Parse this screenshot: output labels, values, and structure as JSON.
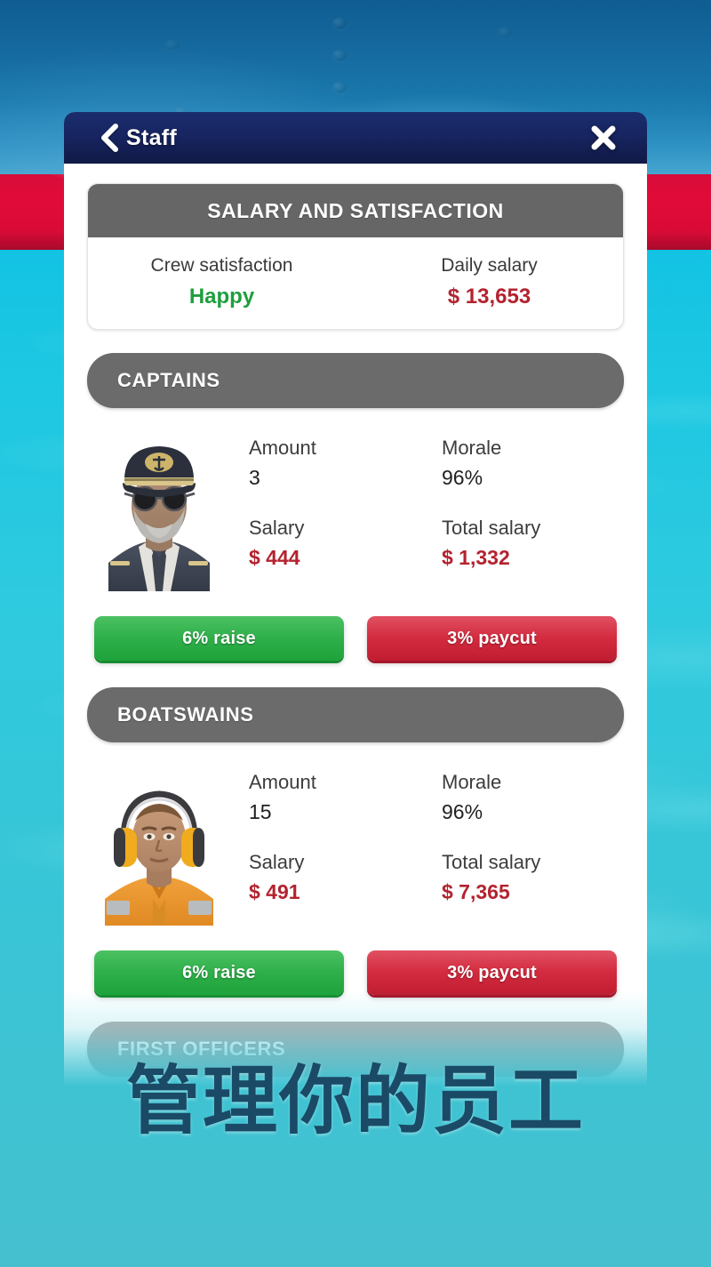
{
  "window": {
    "title": "Staff",
    "back_icon": "chevron-left-icon",
    "close_icon": "close-x-icon"
  },
  "summary": {
    "header": "SALARY AND SATISFACTION",
    "satisfaction_label": "Crew satisfaction",
    "satisfaction_value": "Happy",
    "salary_label": "Daily salary",
    "salary_value": "$ 13,653"
  },
  "labels": {
    "amount": "Amount",
    "morale": "Morale",
    "salary": "Salary",
    "total_salary": "Total salary"
  },
  "sections": [
    {
      "title": "CAPTAINS",
      "avatar_icon": "captain-avatar-icon",
      "amount": "3",
      "morale": "96%",
      "salary": "$ 444",
      "total_salary": "$ 1,332",
      "raise_label": "6% raise",
      "paycut_label": "3% paycut"
    },
    {
      "title": "BOATSWAINS",
      "avatar_icon": "boatswain-avatar-icon",
      "amount": "15",
      "morale": "96%",
      "salary": "$ 491",
      "total_salary": "$ 7,365",
      "raise_label": "6% raise",
      "paycut_label": "3% paycut"
    }
  ],
  "next_section": {
    "title": "FIRST OFFICERS"
  },
  "caption": {
    "text": "管理你的员工"
  },
  "colors": {
    "header_navy": "#172561",
    "section_grey": "#6b6b6b",
    "summary_grey": "#666666",
    "money_red": "#b3232f",
    "happy_green": "#1e9e3e",
    "raise_green": "#2fb04a",
    "paycut_red": "#d42b3f",
    "hull_blue": "#15699e",
    "stripe_red": "#e10b38",
    "water_cyan": "#1ec8e2",
    "caption_color": "#1b4a66"
  }
}
